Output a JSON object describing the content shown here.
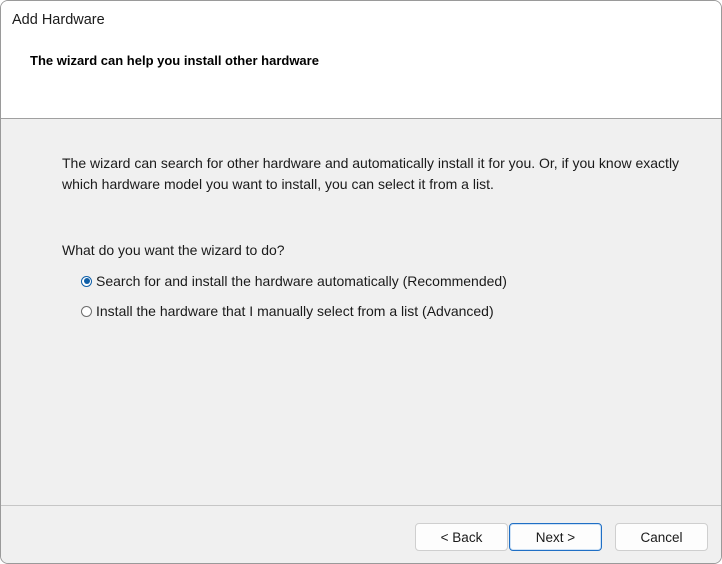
{
  "window": {
    "title": "Add Hardware"
  },
  "header": {
    "heading": "The wizard can help you install other hardware"
  },
  "content": {
    "description": "The wizard can search for other hardware and automatically install it for you. Or, if you know exactly which hardware model you want to install, you can select it from a list.",
    "question": "What do you want the wizard to do?",
    "options": [
      {
        "label": "Search for and install the hardware automatically (Recommended)",
        "selected": true
      },
      {
        "label": "Install the hardware that I manually select from a list (Advanced)",
        "selected": false
      }
    ]
  },
  "footer": {
    "back_label": "< Back",
    "next_label": "Next >",
    "cancel_label": "Cancel"
  },
  "colors": {
    "accent": "#0f5fa8",
    "background": "#f0f0f0",
    "header_background": "#ffffff"
  }
}
